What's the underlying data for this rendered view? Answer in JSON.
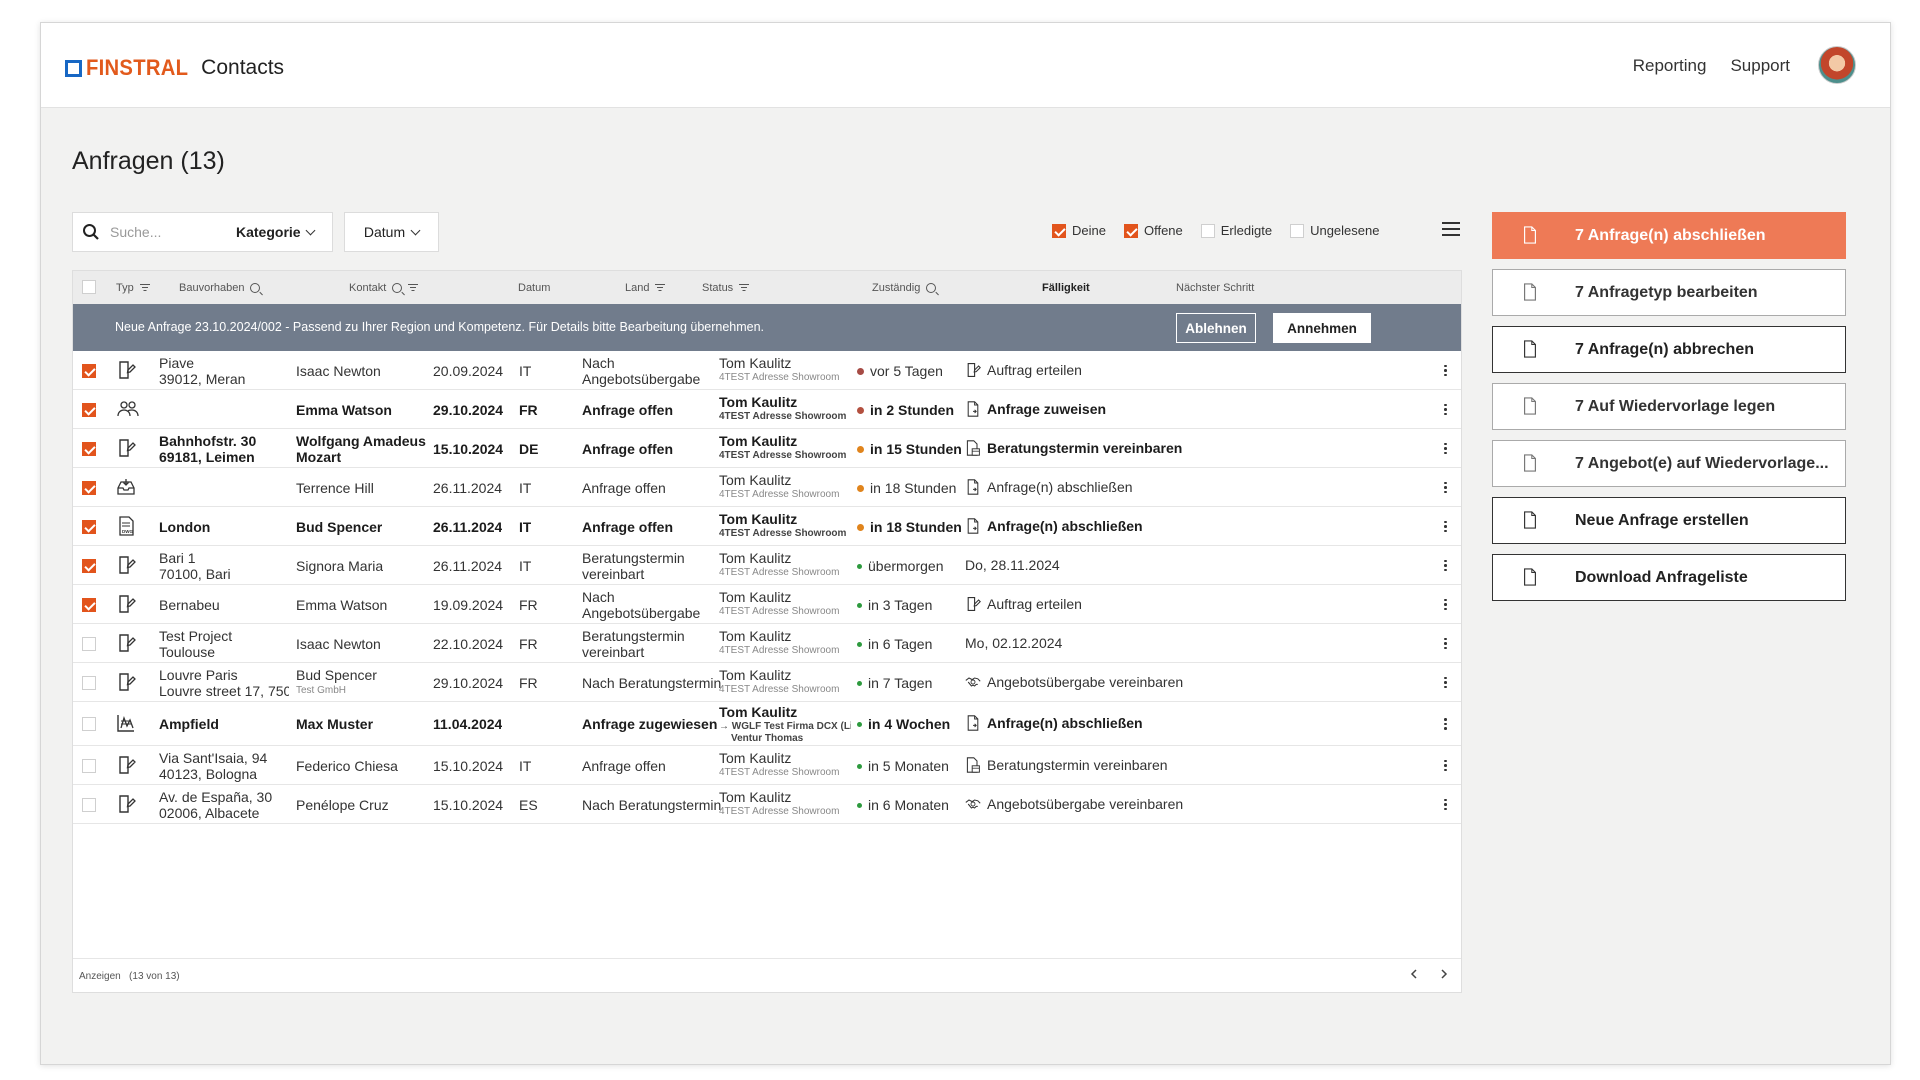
{
  "app": {
    "brand": "FINSTRAL",
    "product": "Contacts"
  },
  "nav": {
    "reporting": "Reporting",
    "support": "Support"
  },
  "page": {
    "title": "Anfragen (13)"
  },
  "toolbar": {
    "search_placeholder": "Suche...",
    "category_label": "Kategorie",
    "date_label": "Datum",
    "filters": [
      {
        "label": "Deine",
        "checked": true
      },
      {
        "label": "Offene",
        "checked": true
      },
      {
        "label": "Erledigte",
        "checked": false
      },
      {
        "label": "Ungelesene",
        "checked": false
      }
    ]
  },
  "table": {
    "headers": {
      "typ": "Typ",
      "bauvorhaben": "Bauvorhaben",
      "kontakt": "Kontakt",
      "datum": "Datum",
      "land": "Land",
      "status": "Status",
      "zustaendig": "Zuständig",
      "faelligkeit": "Fälligkeit",
      "naechster_schritt": "Nächster Schritt"
    },
    "banner": {
      "text": "Neue Anfrage 23.10.2024/002 - Passend zu Ihrer Region und Kompetenz. Für Details bitte Bearbeitung übernehmen.",
      "decline": "Ablehnen",
      "accept": "Annehmen"
    },
    "rows": [
      {
        "checked": true,
        "icon": "door-edit-icon",
        "bold": false,
        "proj1": "Piave",
        "proj2": "39012, Meran",
        "contact1": "Isaac Newton",
        "contact2": "",
        "date": "20.09.2024",
        "land": "IT",
        "status1": "Nach",
        "status2": "Angebotsübergabe",
        "owner": "Tom Kaulitz",
        "owner2": "4TEST Adresse Showroom",
        "owner3": "",
        "due": "vor 5 Tagen",
        "due_color": "#a64b45",
        "next": "Auftrag erteilen",
        "next_icon": "door-edit-icon"
      },
      {
        "checked": true,
        "icon": "people-icon",
        "bold": true,
        "proj1": "",
        "proj2": "",
        "contact1": "Emma Watson",
        "contact2": "",
        "date": "29.10.2024",
        "land": "FR",
        "status1": "Anfrage offen",
        "status2": "",
        "owner": "Tom Kaulitz",
        "owner2": "4TEST Adresse Showroom",
        "owner3": "",
        "due": "in 2 Stunden",
        "due_color": "#b3503f",
        "next": "Anfrage zuweisen",
        "next_icon": "doc-arrow-icon"
      },
      {
        "checked": true,
        "icon": "door-edit-icon",
        "bold": true,
        "proj1": "Bahnhofstr. 30",
        "proj2": "69181, Leimen",
        "contact1": "Wolfgang Amadeus",
        "contact2": "Mozart",
        "date": "15.10.2024",
        "land": "DE",
        "status1": "Anfrage offen",
        "status2": "",
        "owner": "Tom Kaulitz",
        "owner2": "4TEST Adresse Showroom",
        "owner3": "",
        "due": "in 15 Stunden",
        "due_color": "#e0841c",
        "next": "Beratungstermin vereinbaren",
        "next_icon": "doc-calendar-icon"
      },
      {
        "checked": true,
        "icon": "inbox-icon",
        "bold": false,
        "proj1": "",
        "proj2": "",
        "contact1": "Terrence Hill",
        "contact2": "",
        "date": "26.11.2024",
        "land": "IT",
        "status1": "Anfrage offen",
        "status2": "",
        "owner": "Tom Kaulitz",
        "owner2": "4TEST Adresse Showroom",
        "owner3": "",
        "due": "in 18 Stunden",
        "due_color": "#e0841c",
        "next": "Anfrage(n) abschließen",
        "next_icon": "doc-arrow-icon"
      },
      {
        "checked": true,
        "icon": "dwg-file-icon",
        "bold": true,
        "proj1": "London",
        "proj2": "",
        "contact1": "Bud Spencer",
        "contact2": "",
        "date": "26.11.2024",
        "land": "IT",
        "status1": "Anfrage offen",
        "status2": "",
        "owner": "Tom Kaulitz",
        "owner2": "4TEST Adresse Showroom",
        "owner3": "",
        "due": "in 18 Stunden",
        "due_color": "#e0841c",
        "next": "Anfrage(n) abschließen",
        "next_icon": "doc-arrow-icon"
      },
      {
        "checked": true,
        "icon": "door-edit-icon",
        "bold": false,
        "proj1": "Bari 1",
        "proj2": "70100, Bari",
        "contact1": "Signora Maria",
        "contact2": "",
        "date": "26.11.2024",
        "land": "IT",
        "status1": "Beratungstermin",
        "status2": "vereinbart",
        "owner": "Tom Kaulitz",
        "owner2": "4TEST Adresse Showroom",
        "owner3": "",
        "due": "übermorgen",
        "due_color": "#2d9a3e",
        "next": "Do, 28.11.2024",
        "next_icon": ""
      },
      {
        "checked": true,
        "icon": "door-edit-icon",
        "bold": false,
        "proj1": "Bernabeu",
        "proj2": "",
        "contact1": "Emma Watson",
        "contact2": "",
        "date": "19.09.2024",
        "land": "FR",
        "status1": "Nach",
        "status2": "Angebotsübergabe",
        "owner": "Tom Kaulitz",
        "owner2": "4TEST Adresse Showroom",
        "owner3": "",
        "due": "in 3 Tagen",
        "due_color": "#2d9a3e",
        "next": "Auftrag erteilen",
        "next_icon": "door-edit-icon"
      },
      {
        "checked": false,
        "icon": "door-edit-icon",
        "bold": false,
        "proj1": "Test Project",
        "proj2": "Toulouse",
        "contact1": "Isaac Newton",
        "contact2": "",
        "date": "22.10.2024",
        "land": "FR",
        "status1": "Beratungstermin",
        "status2": "vereinbart",
        "owner": "Tom Kaulitz",
        "owner2": "4TEST Adresse Showroom",
        "owner3": "",
        "due": "in 6 Tagen",
        "due_color": "#2d9a3e",
        "next": "Mo, 02.12.2024",
        "next_icon": ""
      },
      {
        "checked": false,
        "icon": "door-edit-icon",
        "bold": false,
        "proj1": "Louvre Paris",
        "proj2": "Louvre street 17, 750...",
        "contact1": "Bud Spencer",
        "contact2": "Test GmbH",
        "date": "29.10.2024",
        "land": "FR",
        "status1": "Nach Beratungstermin",
        "status2": "",
        "owner": "Tom Kaulitz",
        "owner2": "4TEST Adresse Showroom",
        "owner3": "",
        "due": "in 7 Tagen",
        "due_color": "#2d9a3e",
        "next": "Angebotsübergabe vereinbaren",
        "next_icon": "handshake-icon"
      },
      {
        "checked": false,
        "icon": "blueprint-icon",
        "bold": true,
        "proj1": "Ampfield",
        "proj2": "",
        "contact1": "Max Muster",
        "contact2": "",
        "date": "11.04.2024",
        "land": "",
        "status1": "Anfrage zugewiesen",
        "status2": "",
        "owner": "Tom Kaulitz",
        "owner2": "→ WGLF Test Firma DCX (Li...",
        "owner3": "Ventur Thomas",
        "due": "in 4 Wochen",
        "due_color": "#2d9a3e",
        "next": "Anfrage(n) abschließen",
        "next_icon": "doc-arrow-icon"
      },
      {
        "checked": false,
        "icon": "door-edit-icon",
        "bold": false,
        "proj1": "Via Sant'Isaia, 94",
        "proj2": "40123, Bologna",
        "contact1": "Federico Chiesa",
        "contact2": "",
        "date": "15.10.2024",
        "land": "IT",
        "status1": "Anfrage offen",
        "status2": "",
        "owner": "Tom Kaulitz",
        "owner2": "4TEST Adresse Showroom",
        "owner3": "",
        "due": "in 5 Monaten",
        "due_color": "#2d9a3e",
        "next": "Beratungstermin vereinbaren",
        "next_icon": "doc-calendar-icon"
      },
      {
        "checked": false,
        "icon": "door-edit-icon",
        "bold": false,
        "proj1": "Av. de España, 30",
        "proj2": "02006, Albacete",
        "contact1": "Penélope Cruz",
        "contact2": "",
        "date": "15.10.2024",
        "land": "ES",
        "status1": "Nach Beratungstermin",
        "status2": "",
        "owner": "Tom Kaulitz",
        "owner2": "4TEST Adresse Showroom",
        "owner3": "",
        "due": "in 6 Monaten",
        "due_color": "#2d9a3e",
        "next": "Angebotsübergabe vereinbaren",
        "next_icon": "handshake-icon"
      }
    ],
    "footer": {
      "label": "Anzeigen",
      "count": "(13 von 13)"
    }
  },
  "actions": [
    {
      "label": "7 Anfrage(n) abschließen",
      "style": "primary"
    },
    {
      "label": "7 Anfragetyp bearbeiten",
      "style": "muted"
    },
    {
      "label": "7 Anfrage(n) abbrechen",
      "style": "default"
    },
    {
      "label": "7 Auf Wiedervorlage legen",
      "style": "muted"
    },
    {
      "label": "7 Angebot(e) auf Wiedervorlage...",
      "style": "muted"
    },
    {
      "label": "Neue Anfrage erstellen",
      "style": "default"
    },
    {
      "label": "Download Anfrageliste",
      "style": "default"
    }
  ],
  "colors": {
    "accent": "#e2541c",
    "primary_button": "#ee7a56",
    "banner": "#717c8c",
    "logo_blue": "#1767c4"
  }
}
